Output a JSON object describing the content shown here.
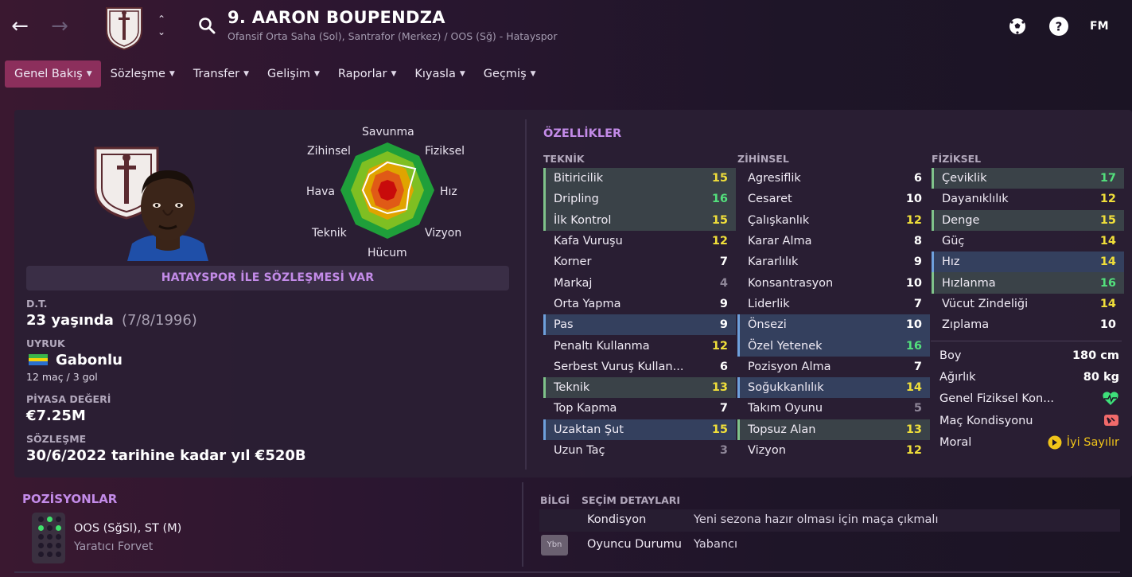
{
  "header": {
    "player_name": "9. AARON BOUPENDZA",
    "subtitle": "Ofansif Orta Saha (Sol), Santrafor (Merkez) / OOS (Sğ) - Hatayspor",
    "fm_label": "FM"
  },
  "tabs": [
    {
      "label": "Genel Bakış"
    },
    {
      "label": "Sözleşme"
    },
    {
      "label": "Transfer"
    },
    {
      "label": "Gelişim"
    },
    {
      "label": "Raporlar"
    },
    {
      "label": "Kıyasla"
    },
    {
      "label": "Geçmiş"
    }
  ],
  "radar": {
    "labels": {
      "top": "Savunma",
      "top_left": "Zihinsel",
      "top_right": "Fiziksel",
      "left": "Hava",
      "right": "Hız",
      "bottom_left": "Teknik",
      "bottom_right": "Vizyon",
      "bottom": "Hücum"
    }
  },
  "contract_banner": "HATAYSPOR İLE SÖZLEŞMESİ VAR",
  "profile": {
    "dob_label": "D.T.",
    "age": "23 yaşında",
    "dob": "(7/8/1996)",
    "nationality_label": "UYRUK",
    "nationality": "Gabonlu",
    "caps": "12 maç / 3 gol",
    "value_label": "PİYASA DEĞERİ",
    "value": "€7.25M",
    "contract_label": "SÖZLEŞME",
    "contract": "30/6/2022 tarihine kadar yıl €520B"
  },
  "attributes": {
    "title": "ÖZELLİKLER",
    "technical_header": "TEKNİK",
    "mental_header": "ZİHİNSEL",
    "physical_header": "FİZİKSEL",
    "technical": [
      {
        "name": "Bitiricilik",
        "value": "15",
        "hl": "green"
      },
      {
        "name": "Dripling",
        "value": "16",
        "hl": "green"
      },
      {
        "name": "İlk Kontrol",
        "value": "15",
        "hl": "green"
      },
      {
        "name": "Kafa Vuruşu",
        "value": "12",
        "hl": ""
      },
      {
        "name": "Korner",
        "value": "7",
        "hl": ""
      },
      {
        "name": "Markaj",
        "value": "4",
        "hl": ""
      },
      {
        "name": "Orta Yapma",
        "value": "9",
        "hl": ""
      },
      {
        "name": "Pas",
        "value": "9",
        "hl": "blue"
      },
      {
        "name": "Penaltı Kullanma",
        "value": "12",
        "hl": ""
      },
      {
        "name": "Serbest Vuruş Kullan...",
        "value": "6",
        "hl": ""
      },
      {
        "name": "Teknik",
        "value": "13",
        "hl": "green"
      },
      {
        "name": "Top Kapma",
        "value": "7",
        "hl": ""
      },
      {
        "name": "Uzaktan Şut",
        "value": "15",
        "hl": "blue"
      },
      {
        "name": "Uzun Taç",
        "value": "3",
        "hl": ""
      }
    ],
    "mental": [
      {
        "name": "Agresiflik",
        "value": "6",
        "hl": ""
      },
      {
        "name": "Cesaret",
        "value": "10",
        "hl": ""
      },
      {
        "name": "Çalışkanlık",
        "value": "12",
        "hl": ""
      },
      {
        "name": "Karar Alma",
        "value": "8",
        "hl": ""
      },
      {
        "name": "Kararlılık",
        "value": "9",
        "hl": ""
      },
      {
        "name": "Konsantrasyon",
        "value": "10",
        "hl": ""
      },
      {
        "name": "Liderlik",
        "value": "7",
        "hl": ""
      },
      {
        "name": "Önsezi",
        "value": "10",
        "hl": "blue"
      },
      {
        "name": "Özel Yetenek",
        "value": "16",
        "hl": "blue"
      },
      {
        "name": "Pozisyon Alma",
        "value": "7",
        "hl": ""
      },
      {
        "name": "Soğukkanlılık",
        "value": "14",
        "hl": "blue"
      },
      {
        "name": "Takım Oyunu",
        "value": "5",
        "hl": ""
      },
      {
        "name": "Topsuz Alan",
        "value": "13",
        "hl": "green"
      },
      {
        "name": "Vizyon",
        "value": "12",
        "hl": ""
      }
    ],
    "physical": [
      {
        "name": "Çeviklik",
        "value": "17",
        "hl": "green"
      },
      {
        "name": "Dayanıklılık",
        "value": "12",
        "hl": ""
      },
      {
        "name": "Denge",
        "value": "15",
        "hl": "green"
      },
      {
        "name": "Güç",
        "value": "14",
        "hl": ""
      },
      {
        "name": "Hız",
        "value": "14",
        "hl": "blue"
      },
      {
        "name": "Hızlanma",
        "value": "16",
        "hl": "green"
      },
      {
        "name": "Vücut Zindeliği",
        "value": "14",
        "hl": ""
      },
      {
        "name": "Zıplama",
        "value": "10",
        "hl": ""
      }
    ],
    "height_label": "Boy",
    "height": "180 cm",
    "weight_label": "Ağırlık",
    "weight": "80 kg",
    "fitness_label": "Genel Fiziksel Kon...",
    "match_label": "Maç Kondisyonu",
    "morale_label": "Moral",
    "morale": "İyi Sayılır"
  },
  "positions": {
    "title": "POZİSYONLAR",
    "main": "OOS (SğSl), ST (M)",
    "role": "Yaratıcı Forvet"
  },
  "info": {
    "header_info": "BİLGİ",
    "header_selection": "SEÇİM DETAYLARI",
    "rows": [
      {
        "key": "Kondisyon",
        "detail": "Yeni sezona hazır olması için maça çıkmalı"
      },
      {
        "key": "Oyuncu Durumu",
        "detail": "Yabancı"
      }
    ],
    "badge": "Ybn"
  },
  "colors": {
    "accent_purple": "#c38be8",
    "active_tab": "#8c2f5c",
    "attr_yellow": "#f0df3a",
    "attr_green": "#53e07c"
  }
}
